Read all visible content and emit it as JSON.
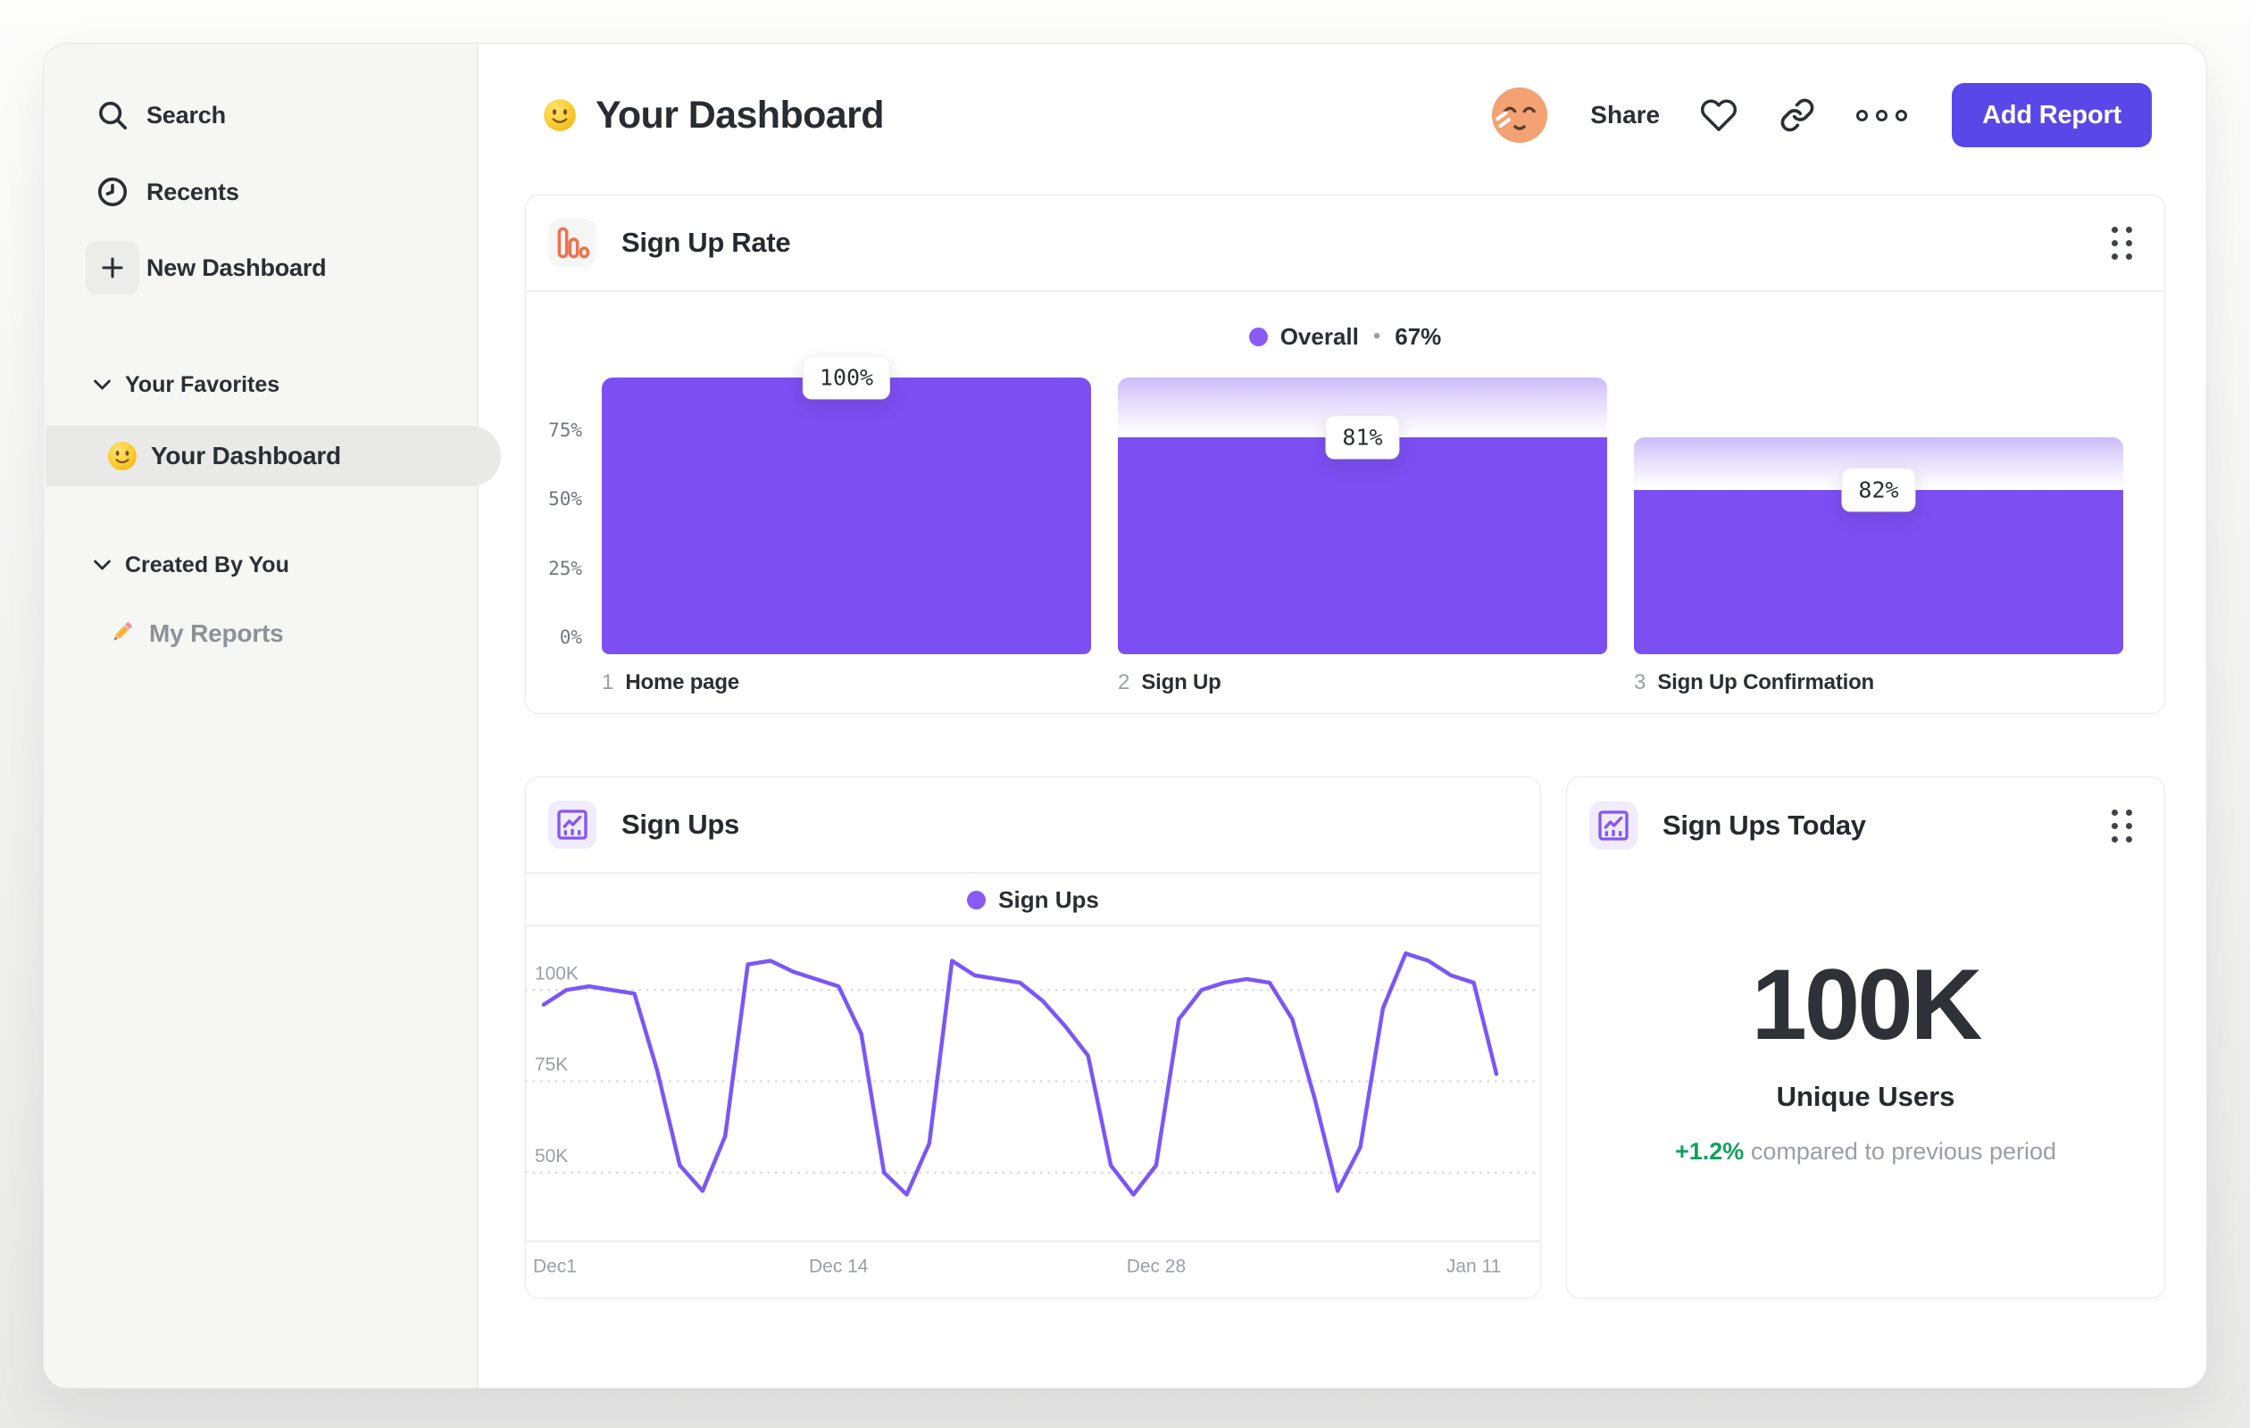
{
  "header": {
    "title": "Your Dashboard",
    "share": "Share",
    "add_report": "Add Report"
  },
  "sidebar": {
    "items": [
      {
        "label": "Search"
      },
      {
        "label": "Recents"
      },
      {
        "label": "New Dashboard"
      }
    ],
    "sections": [
      {
        "title": "Your Favorites"
      },
      {
        "title": "Created By You"
      }
    ],
    "favorites_item": {
      "label": "Your Dashboard",
      "emoji": "smiley",
      "active": true
    },
    "created_item": {
      "label": "My Reports",
      "emoji": "pencil"
    }
  },
  "cards": {
    "signups_today": {
      "title": "Sign Ups Today",
      "value": "100K",
      "subtitle": "Unique Users",
      "delta": "+1.2%",
      "delta_note": "compared to previous period"
    }
  },
  "colors": {
    "accent_purple": "#7C4FF2",
    "line_purple": "#7A57F6",
    "legend_dot": "#8A5BF6",
    "button_indigo": "#5A47E8",
    "icon_orange": "#EF714E",
    "icon_purple": "#8456F0",
    "positive_green": "#0FA15E"
  },
  "chart_data": [
    {
      "id": "sign-up-rate",
      "type": "bar",
      "title": "Sign Up Rate",
      "legend": {
        "label": "Overall",
        "separator": "•",
        "value": "67%"
      },
      "overall_conversion_pct": 67,
      "steps": [
        {
          "index": "1",
          "category": "Home page",
          "conversion_label": "100%",
          "conversion_pct": 100,
          "bar_frac": 1.0,
          "prev_frac": 1.0
        },
        {
          "index": "2",
          "category": "Sign Up",
          "conversion_label": "81%",
          "conversion_pct": 81,
          "bar_frac": 0.784,
          "prev_frac": 1.0
        },
        {
          "index": "3",
          "category": "Sign Up Confirmation",
          "conversion_label": "82%",
          "conversion_pct": 82,
          "bar_frac": 0.594,
          "prev_frac": 0.784
        }
      ],
      "yticks": [
        {
          "label": "75%",
          "pct": 75
        },
        {
          "label": "50%",
          "pct": 50
        },
        {
          "label": "25%",
          "pct": 25
        },
        {
          "label": "0%",
          "pct": 0
        }
      ],
      "ylim": [
        0,
        100
      ],
      "grid": false,
      "colors": {
        "bar": "#7C4FF2",
        "gradient_top": "#CBBCF8"
      }
    },
    {
      "id": "sign-ups",
      "type": "line",
      "title": "Sign Ups",
      "legend": {
        "label": "Sign Ups"
      },
      "x_unit": "day",
      "series": [
        {
          "name": "Sign Ups",
          "values": [
            96,
            100,
            101,
            100,
            99,
            78,
            52,
            45,
            60,
            107,
            108,
            105,
            103,
            101,
            88,
            50,
            44,
            58,
            108,
            104,
            103,
            102,
            97,
            90,
            82,
            52,
            44,
            52,
            92,
            100,
            102,
            103,
            102,
            92,
            70,
            45,
            57,
            95,
            110,
            108,
            104,
            102,
            77
          ]
        }
      ],
      "xticks": [
        {
          "label": "Dec1",
          "day": 0
        },
        {
          "label": "Dec 14",
          "day": 13
        },
        {
          "label": "Dec 28",
          "day": 27
        },
        {
          "label": "Jan 11",
          "day": 41
        }
      ],
      "yticks": [
        {
          "label": "100K",
          "value": 100
        },
        {
          "label": "75K",
          "value": 75
        },
        {
          "label": "50K",
          "value": 50
        }
      ],
      "ylim_k": [
        40,
        112
      ],
      "grid": "dotted-horizontal",
      "legend_position": "top-center",
      "colors": {
        "line": "#7A57F6"
      }
    }
  ]
}
